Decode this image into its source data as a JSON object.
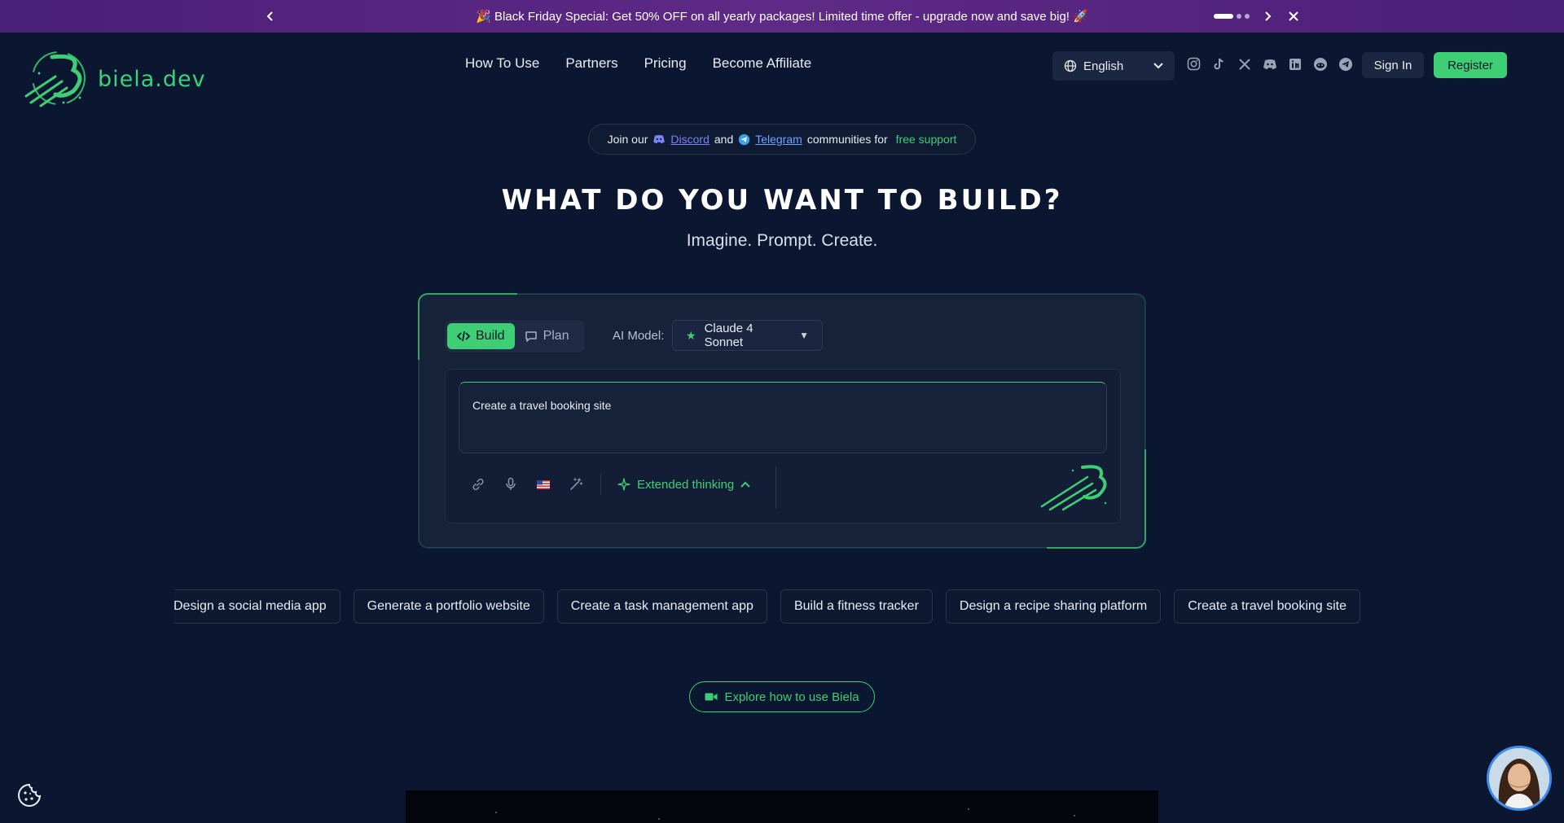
{
  "promo": {
    "text": "🎉 Black Friday Special: Get 50% OFF on all yearly packages! Limited time offer - upgrade now and save big! 🚀",
    "prev_icon": "chevron-left-icon",
    "next_icon": "chevron-right-icon",
    "close_icon": "close-icon"
  },
  "header": {
    "logo_text": "biela.dev",
    "nav": [
      "How To Use",
      "Partners",
      "Pricing",
      "Become Affiliate"
    ],
    "language": "English",
    "socials": [
      "instagram-icon",
      "tiktok-icon",
      "x-icon",
      "discord-icon",
      "linkedin-icon",
      "reddit-icon",
      "telegram-icon"
    ],
    "sign_in": "Sign In",
    "register": "Register"
  },
  "join": {
    "prefix": "Join our",
    "discord": "Discord",
    "and": "and",
    "telegram": "Telegram",
    "suffix": "communities for",
    "free": "free support"
  },
  "hero": {
    "title": "WHAT DO YOU WANT TO BUILD?",
    "subtitle": "Imagine. Prompt. Create."
  },
  "builder": {
    "modes": [
      "Build",
      "Plan"
    ],
    "active_mode": "Build",
    "ai_label": "AI Model:",
    "ai_model": "Claude 4 Sonnet",
    "prompt": "Create a travel booking site",
    "extended": "Extended thinking"
  },
  "suggestions": [
    "Design a social media app",
    "Generate a portfolio website",
    "Create a task management app",
    "Build a fitness tracker",
    "Design a recipe sharing platform",
    "Create a travel booking site"
  ],
  "explore": "Explore how to use Biela",
  "colors": {
    "background": "#0b1630",
    "accent": "#3ecf75",
    "banner": "#5e2a86",
    "link": "#6fa4ff"
  }
}
